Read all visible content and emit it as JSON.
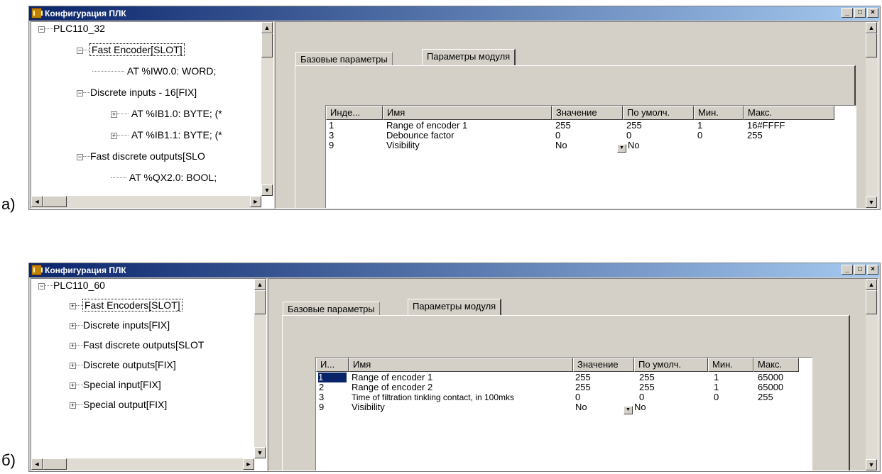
{
  "captions": {
    "a": "a)",
    "b": "б)"
  },
  "windows": [
    {
      "title": "Конфигурация ПЛК",
      "tree": [
        {
          "label": "PLC110_32",
          "toggle": "−"
        },
        {
          "label": "Fast Encoder[SLOT]",
          "toggle": "−"
        },
        {
          "label": "AT %IW0.0: WORD;",
          "toggle": ""
        },
        {
          "label": "Discrete inputs - 16[FIX]",
          "toggle": "−"
        },
        {
          "label": "AT %IB1.0: BYTE; (*",
          "toggle": "+"
        },
        {
          "label": "AT %IB1.1: BYTE; (*",
          "toggle": "+"
        },
        {
          "label": "Fast discrete outputs[SLO",
          "toggle": "−"
        },
        {
          "label": "AT %QX2.0: BOOL;",
          "toggle": ""
        }
      ],
      "tabs": [
        "Базовые параметры",
        "Параметры модуля"
      ],
      "columns": [
        "Инде...",
        "Имя",
        "Значение",
        "По умолч.",
        "Мин.",
        "Макс."
      ],
      "rows": [
        {
          "index": "1",
          "name": "Range of encoder 1",
          "value": "255",
          "default": "255",
          "min": "1",
          "max": "16#FFFF"
        },
        {
          "index": "3",
          "name": "Debounce factor",
          "value": "0",
          "default": "0",
          "min": "0",
          "max": "255"
        },
        {
          "index": "9",
          "name": "Visibility",
          "value": "No",
          "default": "No",
          "min": "",
          "max": ""
        }
      ]
    },
    {
      "title": "Конфигурация ПЛК",
      "tree": [
        {
          "label": "PLC110_60",
          "toggle": "−"
        },
        {
          "label": "Fast Encoders[SLOT]",
          "toggle": "+"
        },
        {
          "label": "Discrete inputs[FIX]",
          "toggle": "+"
        },
        {
          "label": "Fast discrete outputs[SLOT",
          "toggle": "+"
        },
        {
          "label": "Discrete outputs[FIX]",
          "toggle": "+"
        },
        {
          "label": "Special input[FIX]",
          "toggle": "+"
        },
        {
          "label": "Special output[FIX]",
          "toggle": "+"
        }
      ],
      "tabs": [
        "Базовые параметры",
        "Параметры модуля"
      ],
      "columns": [
        "И...",
        "Имя",
        "Значение",
        "По умолч.",
        "Мин.",
        "Макс."
      ],
      "rows": [
        {
          "index": "1",
          "name": "Range of encoder 1",
          "value": "255",
          "default": "255",
          "min": "1",
          "max": "65000"
        },
        {
          "index": "2",
          "name": "Range of encoder 2",
          "value": "255",
          "default": "255",
          "min": "1",
          "max": "65000"
        },
        {
          "index": "3",
          "name": "Time of filtration tinkling contact, in 100mks",
          "value": "0",
          "default": "0",
          "min": "0",
          "max": "255"
        },
        {
          "index": "9",
          "name": "Visibility",
          "value": "No",
          "default": "No",
          "min": "",
          "max": ""
        }
      ]
    }
  ],
  "icons": {
    "minimize": "minimize-icon",
    "maximize": "maximize-icon",
    "close": "close-icon"
  }
}
